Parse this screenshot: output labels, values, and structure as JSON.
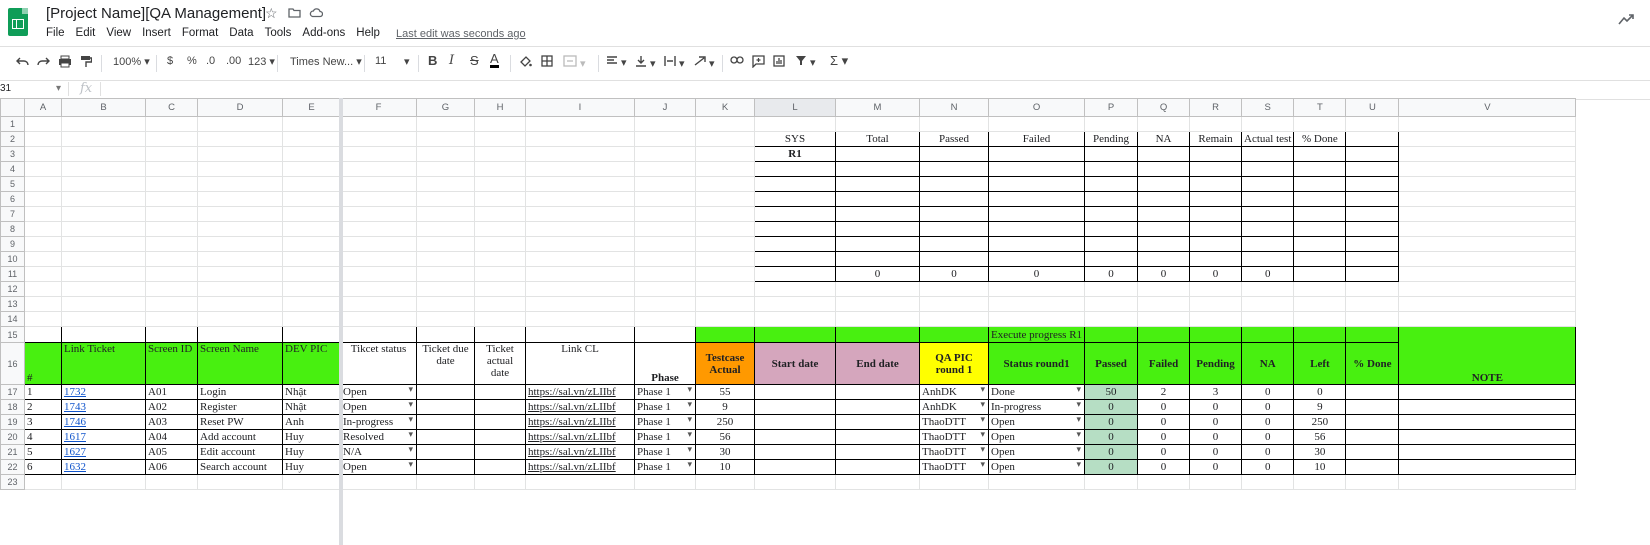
{
  "app": {
    "doc_title": "[Project Name][QA Management]",
    "menu": [
      "File",
      "Edit",
      "View",
      "Insert",
      "Format",
      "Data",
      "Tools",
      "Add-ons",
      "Help"
    ],
    "last_edit": "Last edit was seconds ago"
  },
  "toolbar": {
    "zoom": "100%",
    "currency": "$",
    "percent": "%",
    "dec_decrease": ".0",
    "dec_increase": ".00",
    "more_formats": "123",
    "font": "Times New...",
    "font_size": "11",
    "bold": "B",
    "italic": "I",
    "strike": "S",
    "text_color": "A",
    "sum": "Σ"
  },
  "formula_bar": {
    "name_box": "31",
    "fx": "fx"
  },
  "columns": [
    "A",
    "B",
    "C",
    "D",
    "E",
    "F",
    "G",
    "H",
    "I",
    "J",
    "K",
    "L",
    "M",
    "N",
    "O",
    "P",
    "Q",
    "R",
    "S",
    "T",
    "U",
    "V"
  ],
  "rows": [
    "1",
    "2",
    "3",
    "4",
    "5",
    "6",
    "7",
    "8",
    "9",
    "10",
    "11",
    "12",
    "13",
    "14",
    "15",
    "16",
    "17",
    "18",
    "19",
    "20",
    "21",
    "22",
    "23"
  ],
  "summary": {
    "headers": [
      "SYS",
      "Total",
      "Passed",
      "Failed",
      "Pending",
      "NA",
      "Remain",
      "Actual test",
      "% Done"
    ],
    "r1_label": "R1",
    "totals": [
      "0",
      "0",
      "0",
      "0",
      "0",
      "0",
      "0"
    ]
  },
  "execute_label": "Execute progress R1",
  "table_headers": {
    "no": "#",
    "link_ticket": "Link Ticket",
    "screen_id": "Screen ID",
    "screen_name": "Screen Name",
    "dev_pic": "DEV PIC",
    "ticket_status": "Tikcet status",
    "ticket_due": "Ticket due date",
    "ticket_actual": "Ticket actual date",
    "link_cl": "Link CL",
    "phase": "Phase",
    "testcase_actual": "Testcase Actual",
    "start_date": "Start date",
    "end_date": "End date",
    "qa_pic": "QA PIC round 1",
    "status_round": "Status round1",
    "passed": "Passed",
    "failed": "Failed",
    "pending": "Pending",
    "na": "NA",
    "left": "Left",
    "done": "% Done",
    "note": "NOTE"
  },
  "rows_data": [
    {
      "no": "1",
      "ticket": "1732",
      "sid": "A01",
      "name": "Login",
      "dev": "Nhật",
      "status": "Open",
      "cl": "https://sal.vn/zLIIbf",
      "phase": "Phase 1",
      "tc": "55",
      "qa": "AnhDK",
      "sr": "Done",
      "passed": "50",
      "failed": "2",
      "pending": "3",
      "na": "0",
      "left": "0"
    },
    {
      "no": "2",
      "ticket": "1743",
      "sid": "A02",
      "name": "Register",
      "dev": "Nhật",
      "status": "Open",
      "cl": "https://sal.vn/zLIIbf",
      "phase": "Phase 1",
      "tc": "9",
      "qa": "AnhDK",
      "sr": "In-progress",
      "passed": "0",
      "failed": "0",
      "pending": "0",
      "na": "0",
      "left": "9"
    },
    {
      "no": "3",
      "ticket": "1746",
      "sid": "A03",
      "name": "Reset PW",
      "dev": "Anh",
      "status": "In-progress",
      "cl": "https://sal.vn/zLIIbf",
      "phase": "Phase 1",
      "tc": "250",
      "qa": "ThaoDTT",
      "sr": "Open",
      "passed": "0",
      "failed": "0",
      "pending": "0",
      "na": "0",
      "left": "250"
    },
    {
      "no": "4",
      "ticket": "1617",
      "sid": "A04",
      "name": "Add account",
      "dev": "Huy",
      "status": "Resolved",
      "cl": "https://sal.vn/zLIIbf",
      "phase": "Phase 1",
      "tc": "56",
      "qa": "ThaoDTT",
      "sr": "Open",
      "passed": "0",
      "failed": "0",
      "pending": "0",
      "na": "0",
      "left": "56"
    },
    {
      "no": "5",
      "ticket": "1627",
      "sid": "A05",
      "name": "Edit account",
      "dev": "Huy",
      "status": "N/A",
      "cl": "https://sal.vn/zLIIbf",
      "phase": "Phase 1",
      "tc": "30",
      "qa": "ThaoDTT",
      "sr": "Open",
      "passed": "0",
      "failed": "0",
      "pending": "0",
      "na": "0",
      "left": "30"
    },
    {
      "no": "6",
      "ticket": "1632",
      "sid": "A06",
      "name": "Search account",
      "dev": "Huy",
      "status": "Open",
      "cl": "https://sal.vn/zLIIbf",
      "phase": "Phase 1",
      "tc": "10",
      "qa": "ThaoDTT",
      "sr": "Open",
      "passed": "0",
      "failed": "0",
      "pending": "0",
      "na": "0",
      "left": "10"
    }
  ]
}
